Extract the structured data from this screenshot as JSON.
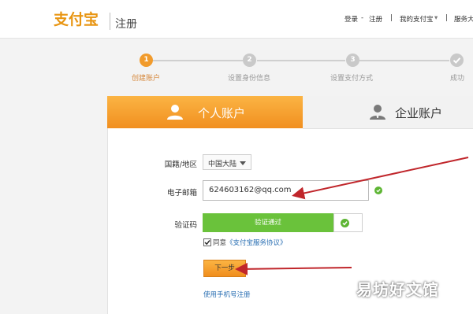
{
  "header": {
    "logo": "支付宝",
    "page_tag": "注册",
    "nav": {
      "login": "登录",
      "register": "注册",
      "my_alipay": "我的支付宝",
      "service": "服务大"
    }
  },
  "steps": [
    {
      "num": "1",
      "label": "创建账户"
    },
    {
      "num": "2",
      "label": "设置身份信息"
    },
    {
      "num": "3",
      "label": "设置支付方式"
    },
    {
      "num": "",
      "label": "成功"
    }
  ],
  "tabs": {
    "personal": "个人账户",
    "business": "企业账户"
  },
  "form": {
    "region_label": "国籍/地区",
    "region_value": "中国大陆",
    "email_label": "电子邮箱",
    "email_value": "624603162@qq.com",
    "captcha_label": "验证码",
    "captcha_status": "验证通过",
    "agree_prefix": "同意",
    "agree_link": "《支付宝服务协议》",
    "next_button": "下一步",
    "phone_link": "使用手机号注册"
  },
  "watermark": "易坊好文馆",
  "colors": {
    "brand_orange": "#f19b2c",
    "success_green": "#6ac23b",
    "arrow_red": "#c0262b",
    "link_blue": "#2a6fb3"
  }
}
